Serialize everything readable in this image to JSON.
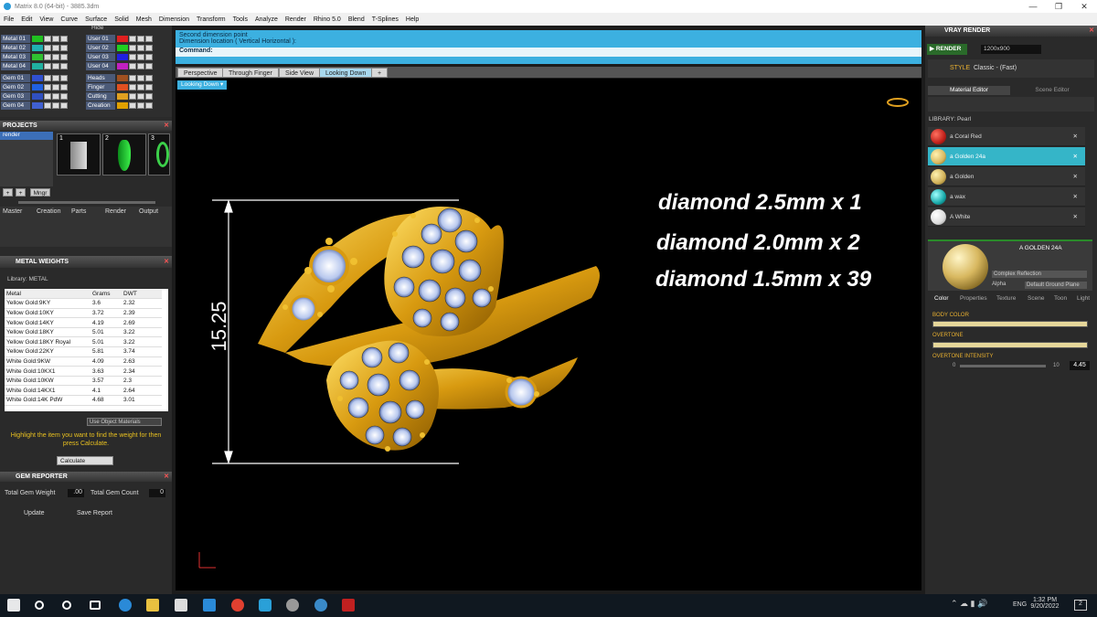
{
  "window": {
    "title": "Matrix 8.0 (64-bit) - 3885.3dm"
  },
  "menu": [
    "File",
    "Edit",
    "View",
    "Curve",
    "Surface",
    "Solid",
    "Mesh",
    "Dimension",
    "Transform",
    "Tools",
    "Analyze",
    "Render",
    "Rhino 5.0",
    "Blend",
    "T-Splines",
    "Help"
  ],
  "layers": {
    "left": [
      {
        "name": "Metal 01",
        "color": "#20c020"
      },
      {
        "name": "Metal 02",
        "color": "#20b0b0"
      },
      {
        "name": "Metal 03",
        "color": "#30c030"
      },
      {
        "name": "Metal 04",
        "color": "#20b0a0"
      },
      {
        "name": "Gem 01",
        "color": "#3050d0"
      },
      {
        "name": "Gem 02",
        "color": "#2060e0"
      },
      {
        "name": "Gem 03",
        "color": "#3050c0"
      },
      {
        "name": "Gem 04",
        "color": "#4060d0"
      }
    ],
    "right": [
      {
        "name": "User 01",
        "color": "#e02020"
      },
      {
        "name": "User 02",
        "color": "#20d020"
      },
      {
        "name": "User 03",
        "color": "#2020e0"
      },
      {
        "name": "User 04",
        "color": "#c020c0"
      },
      {
        "name": "Heads",
        "color": "#a05020"
      },
      {
        "name": "Finger",
        "color": "#e05020"
      },
      {
        "name": "Cutting",
        "color": "#e0a020"
      },
      {
        "name": "Creation",
        "color": "#e0a000"
      }
    ],
    "hide_label": "Hide"
  },
  "projects": {
    "header": "PROJECTS",
    "item": "render",
    "thumb_numbers": [
      "1",
      "2",
      "3"
    ],
    "buttons": [
      "Mngr"
    ],
    "tabs": [
      "Master",
      "Creation",
      "Parts",
      "Render",
      "Output"
    ]
  },
  "metal_weights": {
    "header": "METAL WEIGHTS",
    "library": "Library: METAL",
    "columns": [
      "Metal",
      "Grams",
      "DWT"
    ],
    "rows": [
      [
        "Yellow Gold:9KY",
        "3.6",
        "2.32"
      ],
      [
        "Yellow Gold:10KY",
        "3.72",
        "2.39"
      ],
      [
        "Yellow Gold:14KY",
        "4.19",
        "2.69"
      ],
      [
        "Yellow Gold:18KY",
        "5.01",
        "3.22"
      ],
      [
        "Yellow Gold:18KY Royal",
        "5.01",
        "3.22"
      ],
      [
        "Yellow Gold:22KY",
        "5.81",
        "3.74"
      ],
      [
        "White Gold:9KW",
        "4.09",
        "2.63"
      ],
      [
        "White Gold:10KX1",
        "3.63",
        "2.34"
      ],
      [
        "White Gold:10KW",
        "3.57",
        "2.3"
      ],
      [
        "White Gold:14KX1",
        "4.1",
        "2.64"
      ],
      [
        "White Gold:14K PdW",
        "4.68",
        "3.01"
      ]
    ],
    "use_object_materials": "Use Object Materials",
    "hint": "Highlight the item you want to find the weight for then press Calculate.",
    "calculate": "Calculate"
  },
  "gem_reporter": {
    "header": "GEM REPORTER",
    "total_weight_label": "Total Gem Weight",
    "total_weight_value": ".00",
    "total_count_label": "Total Gem Count",
    "total_count_value": "0",
    "update": "Update",
    "save_report": "Save Report"
  },
  "command": {
    "line1": "Second dimension point",
    "line2": "Dimension location ( Vertical  Horizontal ):",
    "prompt": "Command:"
  },
  "viewport_tabs": [
    "Perspective",
    "Through Finger",
    "Side View",
    "Looking Down"
  ],
  "active_view_label": "Looking Down",
  "viewport": {
    "dimension": "15.25",
    "annotations": [
      "diamond 2.5mm x 1",
      "diamond 2.0mm x 2",
      "diamond 1.5mm x 39"
    ]
  },
  "vray": {
    "header": "VRAY RENDER",
    "render_btn": "RENDER",
    "resolution": "1200x900",
    "style_label": "STYLE",
    "style_value": "Classic - (Fast)",
    "tabs": [
      "Material Editor",
      "Scene Editor"
    ],
    "library": "LIBRARY: Pearl",
    "materials": [
      {
        "name": "a Coral Red",
        "color": "#c0201a"
      },
      {
        "name": "a Golden 24a",
        "color": "#d8b860"
      },
      {
        "name": "a Golden",
        "color": "#d0b058"
      },
      {
        "name": "a wax",
        "color": "#18a8a8"
      },
      {
        "name": "A White",
        "color": "#dcdcdc"
      }
    ],
    "selected_material": "A GOLDEN 24A",
    "reflection": "Complex Reflection",
    "alpha_label": "Alpha",
    "ground_plane": "Default Ground Plane",
    "prop_tabs": [
      "Color",
      "Properties",
      "Texture",
      "Scene",
      "Toon",
      "Light"
    ],
    "body_color_label": "BODY COLOR",
    "overtone_label": "OVERTONE",
    "overtone_intensity_label": "OVERTONE INTENSITY",
    "intensity_min": "0",
    "intensity_max": "10",
    "intensity_value": "4.45"
  },
  "taskbar": {
    "language": "ENG",
    "time": "1:32 PM",
    "date": "9/20/2022",
    "notif_count": "2"
  }
}
